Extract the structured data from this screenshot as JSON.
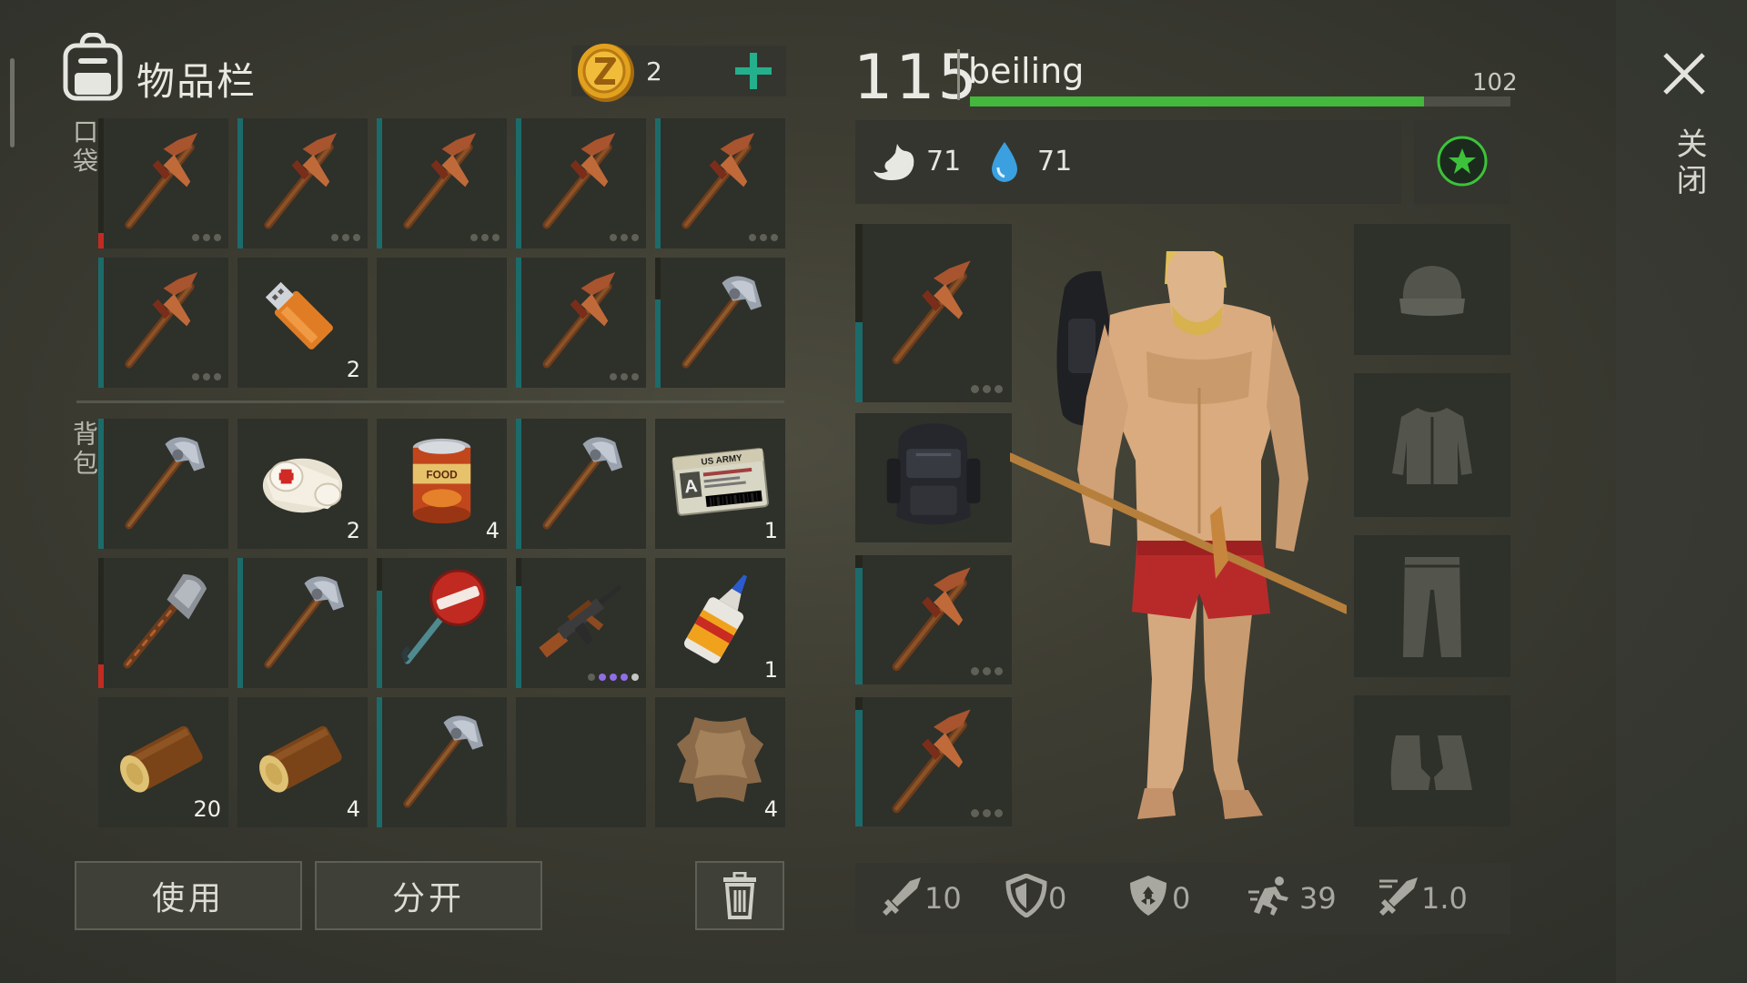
{
  "inventory": {
    "title": "物品栏",
    "coins": "2",
    "pocket_label": "口袋",
    "backpack_label": "背包",
    "use_button": "使用",
    "split_button": "分开",
    "pocket_slots": [
      {
        "item": "pickaxe-icon",
        "count": "",
        "dots": 3,
        "durability": 0.12,
        "bar_color": "#c22b22"
      },
      {
        "item": "pickaxe-icon",
        "count": "",
        "dots": 3,
        "durability": 1.0,
        "bar_color": "#1c6b6b"
      },
      {
        "item": "pickaxe-icon",
        "count": "",
        "dots": 3,
        "durability": 1.0,
        "bar_color": "#1c6b6b"
      },
      {
        "item": "pickaxe-icon",
        "count": "",
        "dots": 3,
        "durability": 1.0,
        "bar_color": "#1c6b6b"
      },
      {
        "item": "pickaxe-icon",
        "count": "",
        "dots": 3,
        "durability": 1.0,
        "bar_color": "#1c6b6b"
      },
      {
        "item": "pickaxe-icon",
        "count": "",
        "dots": 3,
        "durability": 1.0,
        "bar_color": "#1c6b6b"
      },
      {
        "item": "flashdrive-icon",
        "count": "2"
      },
      {
        "item": "",
        "count": ""
      },
      {
        "item": "pickaxe-icon",
        "count": "",
        "dots": 3,
        "durability": 1.0,
        "bar_color": "#1c6b6b"
      },
      {
        "item": "stone-hatchet-icon",
        "count": "",
        "durability": 0.68,
        "bar_color": "#1c6b6b"
      }
    ],
    "backpack_slots": [
      {
        "item": "stone-hatchet-icon",
        "count": "",
        "durability": 1.0,
        "bar_color": "#1c6b6b"
      },
      {
        "item": "bandage-icon",
        "count": "2"
      },
      {
        "item": "canned-food-icon",
        "count": "4"
      },
      {
        "item": "stone-hatchet-icon",
        "count": "",
        "durability": 1.0,
        "bar_color": "#1c6b6b"
      },
      {
        "item": "army-id-card-icon",
        "count": "1",
        "card_text": "US ARMY"
      },
      {
        "item": "shovel-icon",
        "count": "",
        "durability": 0.18,
        "bar_color": "#c22b22"
      },
      {
        "item": "stone-hatchet-icon",
        "count": "",
        "durability": 1.0,
        "bar_color": "#1c6b6b"
      },
      {
        "item": "stop-sign-icon",
        "count": "",
        "durability": 0.75,
        "bar_color": "#1c6b6b"
      },
      {
        "item": "assault-rifle-icon",
        "count": "",
        "dots_colors": [
          "#5f6056",
          "#8f6ee6",
          "#8f6ee6",
          "#8f6ee6",
          "#c6c6c0"
        ],
        "durability": 0.78,
        "bar_color": "#1c6b6b"
      },
      {
        "item": "super-glue-icon",
        "count": "1"
      },
      {
        "item": "log-icon",
        "count": "20"
      },
      {
        "item": "log-icon",
        "count": "4"
      },
      {
        "item": "stone-hatchet-icon",
        "count": "",
        "durability": 1.0,
        "bar_color": "#1c6b6b"
      },
      {
        "item": "",
        "count": ""
      },
      {
        "item": "animal-hide-icon",
        "count": "4"
      }
    ]
  },
  "player": {
    "level": "115",
    "name": "beiling",
    "xp_max": "102",
    "xp_fraction": 0.84,
    "hunger": "71",
    "thirst": "71"
  },
  "close_label": "关闭",
  "equipment_left": [
    {
      "item": "pickaxe-icon",
      "dots": 3,
      "durability": 0.45
    },
    {
      "item": "backpack-icon"
    },
    {
      "item": "pickaxe-icon",
      "dots": 3,
      "durability": 0.9
    },
    {
      "item": "pickaxe-icon",
      "dots": 3,
      "durability": 0.9
    }
  ],
  "equipment_right": [
    {
      "slot": "hat-slot-icon"
    },
    {
      "slot": "jacket-slot-icon"
    },
    {
      "slot": "pants-slot-icon"
    },
    {
      "slot": "boots-slot-icon"
    }
  ],
  "stats": {
    "attack": "10",
    "defense": "0",
    "radiation_defense": "0",
    "speed": "39",
    "attack_speed": "1.0"
  },
  "colors": {
    "accent_green": "#43b83c",
    "durability_teal": "#1c6b6b",
    "durability_red": "#c22b22"
  }
}
